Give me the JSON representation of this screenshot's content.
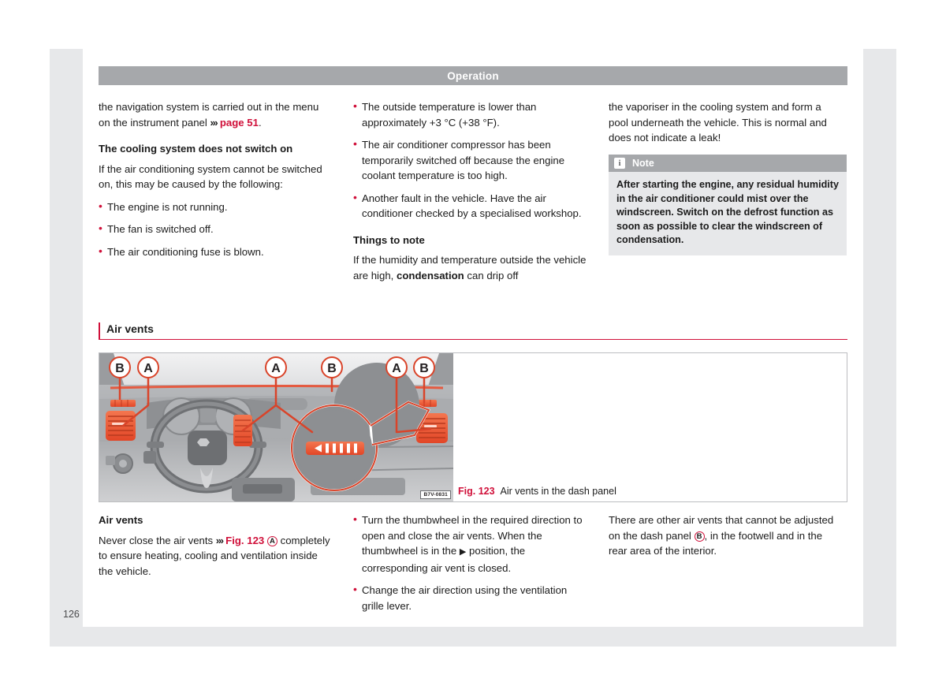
{
  "page": {
    "number": "126",
    "running_header": "Operation"
  },
  "col1": {
    "intro_a": "the navigation system is carried out in the",
    "intro_b": "menu on the instrument panel ",
    "intro_ref": "page 51",
    "intro_end": ".",
    "heading": "The cooling system does not switch on",
    "para": "If the air conditioning system cannot be switched on, this may be caused by the following:",
    "bullets": [
      "The engine is not running.",
      "The fan is switched off.",
      "The air conditioning fuse is blown."
    ]
  },
  "col2": {
    "bullets": [
      "The outside temperature is lower than approximately +3 °C (+38 °F).",
      "The air conditioner compressor has been temporarily switched off because the engine coolant temperature is too high.",
      "Another fault in the vehicle. Have the air conditioner checked by a specialised workshop."
    ],
    "heading": "Things to note",
    "para_a": "If the humidity and temperature outside the vehicle are high, ",
    "para_bold": "condensation",
    "para_b": " can drip off"
  },
  "col3": {
    "para": "the vaporiser in the cooling system and form a pool underneath the vehicle. This is normal and does not indicate a leak!",
    "note": {
      "icon": "info-icon",
      "title": "Note",
      "body": "After starting the engine, any residual humidity in the air conditioner could mist over the windscreen. Switch on the defrost function as soon as possible to clear the windscreen of condensation."
    }
  },
  "section": {
    "heading": "Air vents"
  },
  "figure": {
    "fig_number": "Fig. 123",
    "caption": "Air vents in the dash panel",
    "image_code": "B7V-0831",
    "callouts": [
      "B",
      "A",
      "A",
      "B",
      "A",
      "B"
    ]
  },
  "bottom": {
    "col1": {
      "heading": "Air vents",
      "text_a": "Never close the air vents ",
      "ref": "Fig. 123",
      "circle": "A",
      "text_b": " completely to ensure heating, cooling and ventilation inside the vehicle."
    },
    "col2": {
      "bullet1_a": "Turn the thumbwheel in the required direction to open and close the air vents. When the thumbwheel is in the ",
      "bullet1_glyph": "▶",
      "bullet1_b": " position, the corresponding air vent is closed.",
      "bullet2": "Change the air direction using the ventilation grille lever."
    },
    "col3": {
      "text_a": "There are other air vents that cannot be adjusted on the dash panel ",
      "circle": "B",
      "text_b": ", in the footwell and in the rear area of the interior."
    }
  },
  "colors": {
    "accent_red": "#d0103a",
    "header_gray": "#a6a8ab",
    "note_bg": "#e7e8ea",
    "vent_orange": "#f15a3c"
  }
}
